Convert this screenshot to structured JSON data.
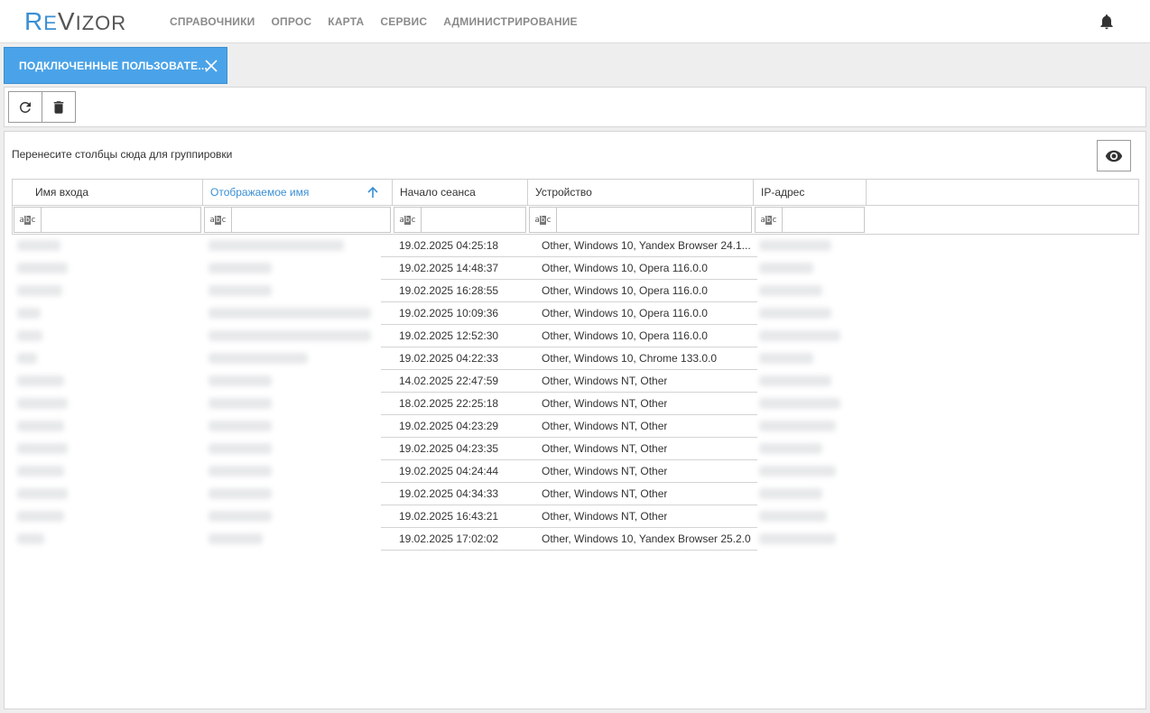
{
  "app": {
    "logo_re": "R",
    "logo_e": "E",
    "logo_v": "V",
    "logo_izor": "IZOR",
    "nav": [
      "СПРАВОЧНИКИ",
      "ОПРОС",
      "КАРТА",
      "СЕРВИС",
      "АДМИНИСТРИРОВАНИЕ"
    ]
  },
  "tab": {
    "label": "ПОДКЛЮЧЕННЫЕ ПОЛЬЗОВАТЕ..."
  },
  "toolbar": {
    "refresh_icon": "refresh-icon",
    "trash_icon": "trash-icon"
  },
  "panel": {
    "group_hint": "Перенесите столбцы сюда для группировки"
  },
  "grid": {
    "columns": [
      "Имя входа",
      "Отображаемое имя",
      "Начало сеанса",
      "Устройство",
      "IP-адрес"
    ],
    "sorted_column": "Отображаемое имя",
    "filter_icon": "abc",
    "rows": [
      {
        "session": "19.02.2025 04:25:18",
        "device": "Other, Windows 10, Yandex Browser 24.1..."
      },
      {
        "session": "19.02.2025 14:48:37",
        "device": "Other, Windows 10, Opera 116.0.0"
      },
      {
        "session": "19.02.2025 16:28:55",
        "device": "Other, Windows 10, Opera 116.0.0"
      },
      {
        "session": "19.02.2025 10:09:36",
        "device": "Other, Windows 10, Opera 116.0.0"
      },
      {
        "session": "19.02.2025 12:52:30",
        "device": "Other, Windows 10, Opera 116.0.0"
      },
      {
        "session": "19.02.2025 04:22:33",
        "device": "Other, Windows 10, Chrome 133.0.0"
      },
      {
        "session": "14.02.2025 22:47:59",
        "device": "Other, Windows NT, Other"
      },
      {
        "session": "18.02.2025 22:25:18",
        "device": "Other, Windows NT, Other"
      },
      {
        "session": "19.02.2025 04:23:29",
        "device": "Other, Windows NT, Other"
      },
      {
        "session": "19.02.2025 04:23:35",
        "device": "Other, Windows NT, Other"
      },
      {
        "session": "19.02.2025 04:24:44",
        "device": "Other, Windows NT, Other"
      },
      {
        "session": "19.02.2025 04:34:33",
        "device": "Other, Windows NT, Other"
      },
      {
        "session": "19.02.2025 16:43:21",
        "device": "Other, Windows NT, Other"
      },
      {
        "session": "19.02.2025 17:02:02",
        "device": "Other, Windows 10, Yandex Browser 25.2.0"
      }
    ]
  },
  "colors": {
    "accent": "#4aa3e8",
    "sorted_header": "#3a8fd4"
  }
}
